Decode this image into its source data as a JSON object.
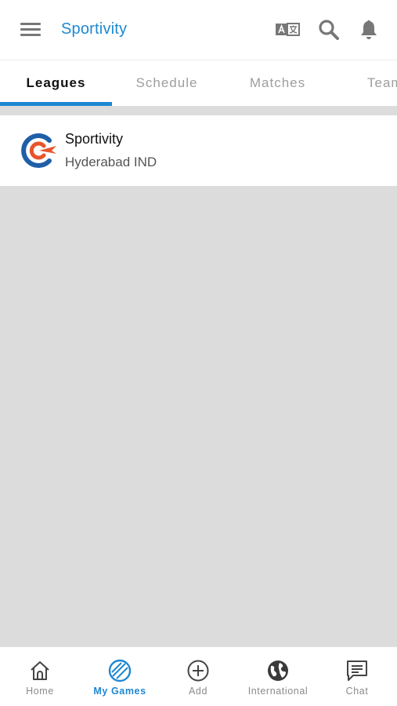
{
  "app_bar": {
    "title": "Sportivity",
    "icons": [
      "menu-icon",
      "translate-icon",
      "search-icon",
      "bell-icon"
    ]
  },
  "tabs": [
    {
      "label": "Leagues",
      "active": true
    },
    {
      "label": "Schedule",
      "active": false
    },
    {
      "label": "Matches",
      "active": false
    },
    {
      "label": "Teams",
      "active": false
    }
  ],
  "leagues": [
    {
      "name": "Sportivity",
      "location": "Hyderabad IND",
      "logo": "sportivity-logo"
    }
  ],
  "bottom_nav": [
    {
      "label": "Home",
      "icon": "home-icon",
      "active": false
    },
    {
      "label": "My Games",
      "icon": "my-games-icon",
      "active": true
    },
    {
      "label": "Add",
      "icon": "add-icon",
      "active": false
    },
    {
      "label": "International",
      "icon": "globe-icon",
      "active": false
    },
    {
      "label": "Chat",
      "icon": "chat-icon",
      "active": false
    }
  ],
  "colors": {
    "accent": "#1e88d2",
    "background": "#dcdcdc",
    "logo_blue": "#1f5fa8",
    "logo_orange": "#e8542b"
  }
}
